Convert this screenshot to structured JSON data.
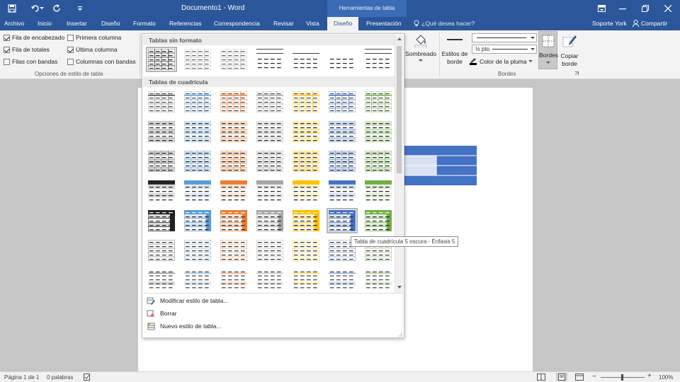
{
  "window": {
    "title": "Documento1 - Word",
    "contextual_header": "Herramientas de tabla"
  },
  "tabs": [
    {
      "label": "Archivo"
    },
    {
      "label": "Inicio"
    },
    {
      "label": "Insertar"
    },
    {
      "label": "Diseño"
    },
    {
      "label": "Formato"
    },
    {
      "label": "Referencias"
    },
    {
      "label": "Correspondencia"
    },
    {
      "label": "Revisar"
    },
    {
      "label": "Vista"
    },
    {
      "label": "Diseño"
    },
    {
      "label": "Presentación"
    }
  ],
  "tell_me": "¿Qué desea hacer?",
  "account": "Soporte York",
  "share": "Compartir",
  "style_options": {
    "checkboxes": [
      {
        "label": "Fila de encabezado",
        "checked": true
      },
      {
        "label": "Fila de totales",
        "checked": true
      },
      {
        "label": "Filas con bandas",
        "checked": false
      },
      {
        "label": "Primera columna",
        "checked": false
      },
      {
        "label": "Última columna",
        "checked": true
      },
      {
        "label": "Columnas con bandas",
        "checked": false
      }
    ],
    "group_label": "Opciones de estilo de tabla"
  },
  "ribbon_right": {
    "shading": "Sombreado",
    "border_styles_1": "Estilos de",
    "border_styles_2": "borde",
    "line_weight": "½ pto",
    "pen_color": "Color de la pluma",
    "borders": "Bordes",
    "copy_format_1": "Copiar",
    "copy_format_2": "borde",
    "group_label": "Bordes"
  },
  "gallery": {
    "section_plain": "Tablas sin formato",
    "section_grid": "Tablas de cuadrícula",
    "menu": [
      "Modificar estilo de tabla...",
      "Borrar",
      "Nuevo estilo de tabla..."
    ]
  },
  "tooltip": "Tabla de cuadrícula 5 oscura - Énfasis 5",
  "status": {
    "page": "Página 1 de 1",
    "words": "0 palabras",
    "zoom": "100%"
  },
  "colors": {
    "brand": "#2b579a",
    "accents": [
      "#222222",
      "#5b9bd5",
      "#ed7d31",
      "#a5a5a5",
      "#ffc000",
      "#4472c4",
      "#70ad47"
    ],
    "light": [
      "#d9d9d9",
      "#deeaf6",
      "#fbe4d5",
      "#ededed",
      "#fff2cc",
      "#d9e2f3",
      "#e2efd9"
    ]
  }
}
